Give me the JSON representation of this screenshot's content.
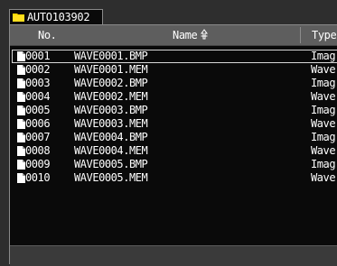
{
  "folder_tab": {
    "label": "AUTO103902",
    "icon": "folder-icon"
  },
  "columns": {
    "no": "No.",
    "name": "Name",
    "type": "Type"
  },
  "sort": {
    "column": "name",
    "icon": "sort-ascending-icon"
  },
  "selected_index": 0,
  "files": [
    {
      "no": "0001",
      "name": "WAVE0001.BMP",
      "type": "Imag"
    },
    {
      "no": "0002",
      "name": "WAVE0001.MEM",
      "type": "Wave"
    },
    {
      "no": "0003",
      "name": "WAVE0002.BMP",
      "type": "Imag"
    },
    {
      "no": "0004",
      "name": "WAVE0002.MEM",
      "type": "Wave"
    },
    {
      "no": "0005",
      "name": "WAVE0003.BMP",
      "type": "Imag"
    },
    {
      "no": "0006",
      "name": "WAVE0003.MEM",
      "type": "Wave"
    },
    {
      "no": "0007",
      "name": "WAVE0004.BMP",
      "type": "Imag"
    },
    {
      "no": "0008",
      "name": "WAVE0004.MEM",
      "type": "Wave"
    },
    {
      "no": "0009",
      "name": "WAVE0005.BMP",
      "type": "Imag"
    },
    {
      "no": "0010",
      "name": "WAVE0005.MEM",
      "type": "Wave"
    }
  ],
  "colors": {
    "background": "#2e2e2e",
    "list": "#0a0a0a",
    "header": "#5e5e5e",
    "folder": "#ffd800",
    "text": "#ffffff"
  }
}
